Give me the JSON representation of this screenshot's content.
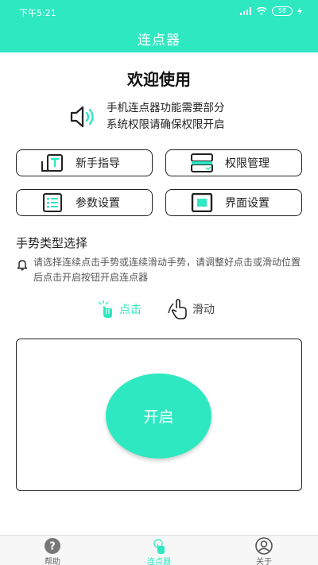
{
  "status_bar": {
    "time": "下午5:21",
    "battery": "58"
  },
  "header": {
    "title": "连点器"
  },
  "welcome": "欢迎使用",
  "notice": {
    "line1": "手机连点器功能需要部分",
    "line2": "系统权限请确保权限开启",
    "icon": "speaker-icon"
  },
  "buttons": [
    {
      "label": "新手指导",
      "icon": "guide-icon"
    },
    {
      "label": "权限管理",
      "icon": "permission-icon"
    },
    {
      "label": "参数设置",
      "icon": "list-icon"
    },
    {
      "label": "界面设置",
      "icon": "screen-icon"
    }
  ],
  "gesture": {
    "title": "手势类型选择",
    "hint": "请选择连续点击手势或连续滑动手势，请调整好点击或滑动位置后点击开启按钮开启连点器",
    "modes": [
      {
        "label": "点击",
        "selected": true,
        "icon": "tap-hand-icon"
      },
      {
        "label": "滑动",
        "selected": false,
        "icon": "swipe-hand-icon"
      }
    ]
  },
  "start_button": {
    "label": "开启"
  },
  "tabs": [
    {
      "label": "帮助",
      "icon": "help-icon",
      "active": false
    },
    {
      "label": "连点器",
      "icon": "clicker-icon",
      "active": true
    },
    {
      "label": "关于",
      "icon": "user-icon",
      "active": false
    }
  ],
  "colors": {
    "accent": "#2ee8c2",
    "text": "#222222",
    "muted": "#666666"
  }
}
